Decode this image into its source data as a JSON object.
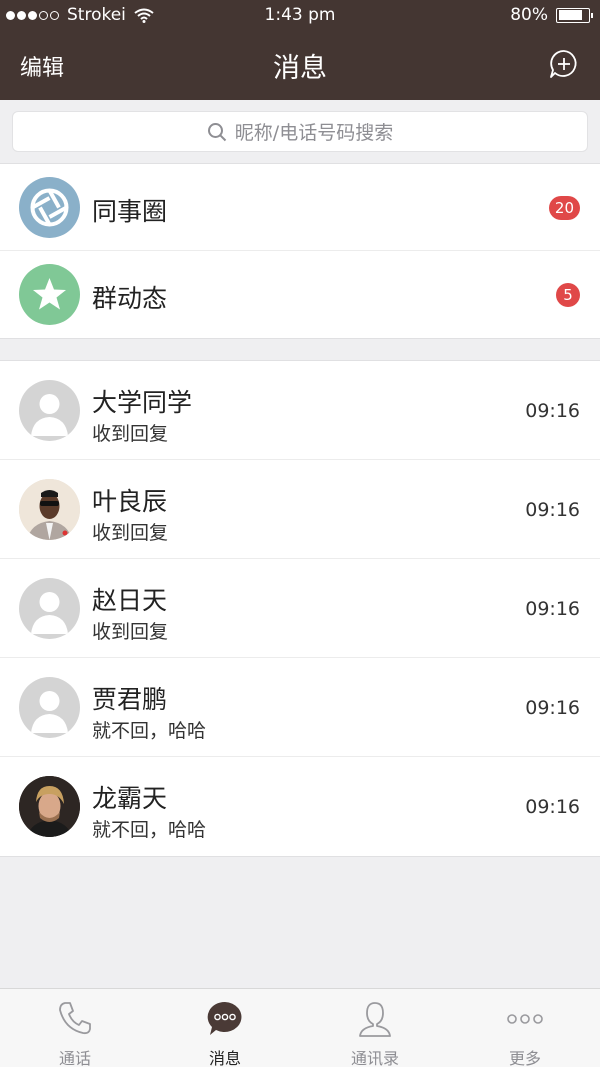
{
  "status_bar": {
    "carrier": "Strokei",
    "time": "1:43 pm",
    "battery": "80%",
    "signal_full": 3,
    "signal_total": 5
  },
  "nav": {
    "edit_label": "编辑",
    "title": "消息"
  },
  "search": {
    "placeholder": "昵称/电话号码搜索"
  },
  "feeds": [
    {
      "label": "同事圈",
      "badge": "20",
      "color": "#8ab0c9",
      "icon": "camera-shutter-icon"
    },
    {
      "label": "群动态",
      "badge": "5",
      "color": "#80c896",
      "icon": "star-icon"
    }
  ],
  "messages": [
    {
      "name": "大学同学",
      "preview": "收到回复",
      "time": "09:16",
      "avatar": "default"
    },
    {
      "name": "叶良辰",
      "preview": "收到回复",
      "time": "09:16",
      "avatar": "photo-man-sunglasses"
    },
    {
      "name": "赵日天",
      "preview": "收到回复",
      "time": "09:16",
      "avatar": "default"
    },
    {
      "name": "贾君鹏",
      "preview": "就不回，哈哈",
      "time": "09:16",
      "avatar": "default"
    },
    {
      "name": "龙霸天",
      "preview": "就不回，哈哈",
      "time": "09:16",
      "avatar": "photo-man-blond"
    }
  ],
  "tabs": [
    {
      "label": "通话",
      "icon": "phone-icon",
      "active": false
    },
    {
      "label": "消息",
      "icon": "chat-bubble-icon",
      "active": true
    },
    {
      "label": "通讯录",
      "icon": "contacts-icon",
      "active": false
    },
    {
      "label": "更多",
      "icon": "more-icon",
      "active": false
    }
  ],
  "colors": {
    "header_bg": "#443632",
    "badge": "#e04848",
    "page_bg": "#efeff1"
  }
}
